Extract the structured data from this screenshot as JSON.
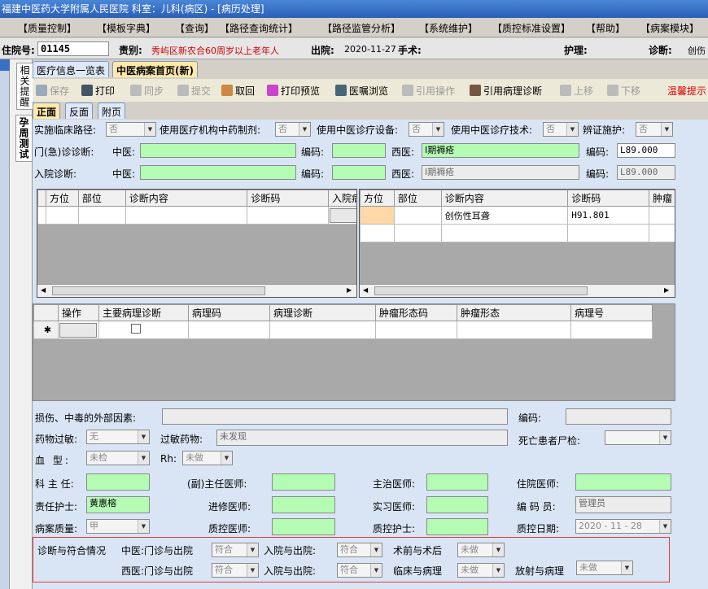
{
  "title": "福建中医药大学附属人民医院 科室：儿科(病区) - [病历处理]",
  "menu": [
    "【质量控制】",
    "【模板字典】",
    "【查询】",
    "【路径查询统计】",
    "【路径监管分析】",
    "【系统维护】",
    "【质控标准设置】",
    "【帮助】",
    "【病案模块】"
  ],
  "info": {
    "inpatient_label": "住院号:",
    "inpatient_no": "01145",
    "category_label": "责别:",
    "category": "秀屿区新农合60周岁以上老年人",
    "discharge_label": "出院:",
    "discharge_date": "2020-11-27",
    "surgery_label": "手术:",
    "nursing_label": "护理:",
    "diagnosis_label": "诊断:",
    "diagnosis_val": "创伤"
  },
  "left": {
    "tab1": "相关提醒",
    "tab2": "孕周测试"
  },
  "tabs": [
    "医疗信息一览表",
    "中医病案首页(新)"
  ],
  "toolbar": {
    "save": "保存",
    "print": "打印",
    "sync": "同步",
    "submit": "提交",
    "retrieve": "取回",
    "preview": "打印预览",
    "order_view": "医嘱浏览",
    "ref_op": "引用操作",
    "ref_path": "引用病理诊断",
    "up": "上移",
    "down": "下移",
    "warning": "温馨提示"
  },
  "subtabs": [
    "正面",
    "反面",
    "附页"
  ],
  "row1": {
    "path_label": "实施临床路径:",
    "path_val": "否",
    "prep_label": "使用医疗机构中药制剂:",
    "prep_val": "否",
    "equip_label": "使用中医诊疗设备:",
    "equip_val": "否",
    "tech_label": "使用中医诊疗技术:",
    "tech_val": "否",
    "bz_label": "辨证施护:",
    "bz_val": "否"
  },
  "outpatient": {
    "label": "门(急)诊诊断:",
    "tcm_label": "中医:",
    "code_label": "编码:",
    "wm_label": "西医:",
    "wm_val": "Ⅰ期褥疮",
    "wm_code": "L89.000"
  },
  "admission": {
    "label": "入院诊断:",
    "tcm_label": "中医:",
    "code_label": "编码:",
    "wm_label": "西医:",
    "wm_val": "Ⅰ期褥疮",
    "wm_code": "L89.000"
  },
  "grid_left": {
    "headers": [
      "方位",
      "部位",
      "诊断内容",
      "诊断码",
      "入院病"
    ]
  },
  "grid_right": {
    "headers": [
      "方位",
      "部位",
      "诊断内容",
      "诊断码",
      "肿瘤"
    ],
    "rows": [
      [
        "",
        "",
        "创伤性耳聋",
        "H91.801",
        ""
      ]
    ]
  },
  "grid_path": {
    "headers": [
      "操作",
      "主要病理诊断",
      "病理码",
      "病理诊断",
      "肿瘤形态码",
      "肿瘤形态",
      "病理号"
    ],
    "star": "✱"
  },
  "fields": {
    "ext_label": "损伤、中毒的外部因素:",
    "code_label": "编码:",
    "allergy_label": "药物过敏:",
    "allergy_val": "无",
    "allergy_drug_label": "过敏药物:",
    "allergy_drug_val": "未发现",
    "autopsy_label": "死亡患者尸检:",
    "blood_label": "血 型:",
    "blood_val": "未检",
    "rh_label": "Rh:",
    "rh_val": "未做",
    "director_label": "科 主 任:",
    "vice_label": "(副)主任医师:",
    "attending_label": "主治医师:",
    "resident_label": "住院医师:",
    "nurse_label": "责任护士:",
    "nurse_val": "黄惠榕",
    "advanced_label": "进修医师:",
    "intern_label": "实习医师:",
    "coder_label": "编 码 员:",
    "coder_val": "管理员",
    "quality_label": "病案质量:",
    "quality_val": "甲",
    "qc_doc_label": "质控医师:",
    "qc_nurse_label": "质控护士:",
    "qc_date_label": "质控日期:",
    "qc_date_val": "2020 - 11 - 28"
  },
  "conform": {
    "title": "诊断与符合情况",
    "tcm_label": "中医:门诊与出院",
    "wm_label": "西医:门诊与出院",
    "in_out": "入院与出院:",
    "val": "符合",
    "pre_post": "术前与术后",
    "clin_path": "临床与病理",
    "radio_path": "放射与病理",
    "undone": "未做"
  }
}
